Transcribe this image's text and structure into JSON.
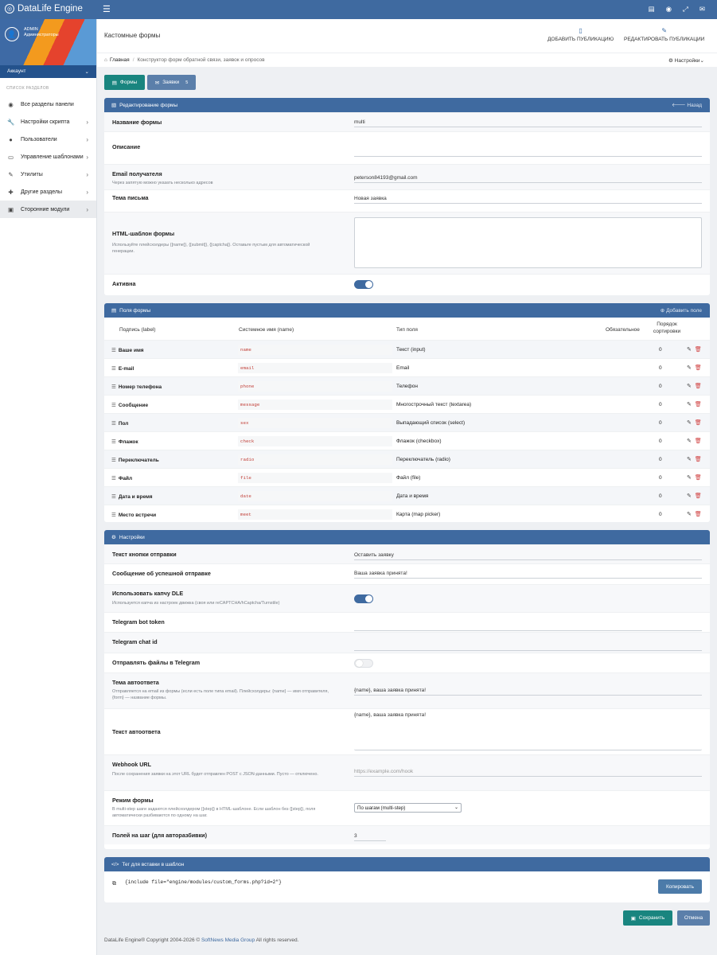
{
  "app": {
    "title": "DataLife Engine"
  },
  "user": {
    "name": "ADMIN",
    "role": "Администраторы",
    "account": "Аккаунт"
  },
  "sidebar": {
    "section": "СПИСОК РАЗДЕЛОВ",
    "items": [
      {
        "label": "Все разделы панели",
        "icon": "globe-icon",
        "chevron": ""
      },
      {
        "label": "Настройки скрипта",
        "icon": "wrench-icon",
        "chevron": "›"
      },
      {
        "label": "Пользователи",
        "icon": "user-icon",
        "chevron": "›"
      },
      {
        "label": "Управление шаблонами",
        "icon": "monitor-icon",
        "chevron": "›"
      },
      {
        "label": "Утилиты",
        "icon": "wand-icon",
        "chevron": "›"
      },
      {
        "label": "Другие разделы",
        "icon": "puzzle-icon",
        "chevron": "›"
      },
      {
        "label": "Сторонние модули",
        "icon": "window-icon",
        "chevron": "›"
      }
    ]
  },
  "header": {
    "page_title": "Кастомные формы",
    "add_pub": "ДОБАВИТЬ ПУБЛИКАЦИЮ",
    "edit_pub": "РЕДАКТИРОВАТЬ ПУБЛИКАЦИИ"
  },
  "breadcrumb": {
    "home": "Главная",
    "sep": "/",
    "current": "Конструктор форм обратной связи, заявок и опросов",
    "settings": "Настройки"
  },
  "tabs": {
    "forms": "Формы",
    "requests": "Заявки",
    "requests_count": "5"
  },
  "edit_panel": {
    "title": "Редактирование формы",
    "back": "Назад",
    "name_label": "Название формы",
    "name_value": "multi",
    "desc_label": "Описание",
    "desc_value": "",
    "email_label": "Email получателя",
    "email_hint": "Через запятую можно указать несколько адресов",
    "email_value": "peterson84193@gmail.com",
    "subject_label": "Тема письма",
    "subject_value": "Новая заявка",
    "html_label": "HTML-шаблон формы",
    "html_hint": "Используйте плейсхолдеры {[name]}, {[submit]}, {[captcha]}. Оставьте пустым для автоматической генерации.",
    "html_value": "",
    "active_label": "Активна",
    "active": true
  },
  "fields_panel": {
    "title": "Поля формы",
    "add": "Добавить поле",
    "columns": {
      "label": "Подпись (label)",
      "name": "Системное имя (name)",
      "type": "Тип поля",
      "required": "Обязательное",
      "sort1": "Порядок",
      "sort2": "сортировки"
    },
    "rows": [
      {
        "label": "Ваше имя",
        "name": "name",
        "type": "Текст (input)",
        "sort": "0"
      },
      {
        "label": "E-mail",
        "name": "email",
        "type": "Email",
        "sort": "0"
      },
      {
        "label": "Номер телефона",
        "name": "phone",
        "type": "Телефон",
        "sort": "0"
      },
      {
        "label": "Сообщение",
        "name": "message",
        "type": "Многострочный текст (textarea)",
        "sort": "0"
      },
      {
        "label": "Пол",
        "name": "sex",
        "type": "Выпадающий список (select)",
        "sort": "0"
      },
      {
        "label": "Флажок",
        "name": "check",
        "type": "Флажок (checkbox)",
        "sort": "0"
      },
      {
        "label": "Переключатель",
        "name": "radio",
        "type": "Переключатель (radio)",
        "sort": "0"
      },
      {
        "label": "Файл",
        "name": "file",
        "type": "Файл (file)",
        "sort": "0"
      },
      {
        "label": "Дата и время",
        "name": "date",
        "type": "Дата и время",
        "sort": "0"
      },
      {
        "label": "Место встречи",
        "name": "meet",
        "type": "Карта (map picker)",
        "sort": "0"
      }
    ]
  },
  "settings_panel": {
    "title": "Настройки",
    "btn_label": "Текст кнопки отправки",
    "btn_value": "Оставить заявку",
    "success_label": "Сообщение об успешной отправке",
    "success_value": "Ваша заявка принята!",
    "captcha_label": "Использовать капчу DLE",
    "captcha_hint": "Используется капча из настроек движка (своя или reCAPTCHA/hCaptcha/Turnstile)",
    "captcha": true,
    "tg_token_label": "Telegram bot token",
    "tg_token_value": "",
    "tg_chat_label": "Telegram chat id",
    "tg_chat_value": "",
    "tg_files_label": "Отправлять файлы в Telegram",
    "tg_files": false,
    "auto_subject_label": "Тема автоответа",
    "auto_subject_hint": "Отправляется на email из формы (если есть поле типа email). Плейсхолдеры: {name} — имя отправителя, {form} — название формы.",
    "auto_subject_value": "{name}, ваша заявка принята!",
    "auto_text_label": "Текст автоответа",
    "auto_text_value": "{name}, ваша заявка принята!",
    "webhook_label": "Webhook URL",
    "webhook_hint": "После сохранения заявки на этот URL будет отправлен POST с JSON-данными. Пусто — отключено.",
    "webhook_placeholder": "https://example.com/hook",
    "mode_label": "Режим формы",
    "mode_hint": "В multi-step шаги задаются плейсхолдером {[step]} в HTML-шаблоне. Если шаблон без {[step]}, поля автоматически разбиваются по одному на шаг.",
    "mode_value": "По шагам (multi-step)",
    "per_step_label": "Полей на шаг (для авторазбивки)",
    "per_step_value": "3"
  },
  "tag_panel": {
    "title": "Тег для вставки в шаблон",
    "code": "{include file=\"engine/modules/custom_forms.php?id=2\"}",
    "copy": "Копировать"
  },
  "actions": {
    "save": "Сохранить",
    "cancel": "Отмена"
  },
  "footer": {
    "pre": "DataLife Engine® Copyright 2004-2026 © ",
    "link": "SoftNews Media Group",
    "post": " All rights reserved."
  }
}
